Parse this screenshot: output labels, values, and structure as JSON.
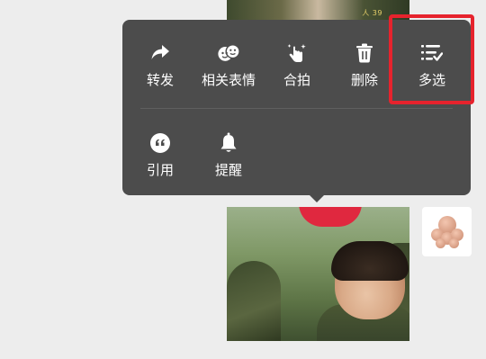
{
  "photo_top": {
    "badge_text": "人 39"
  },
  "menu": {
    "row1": [
      {
        "label": "转发",
        "icon": "forward-icon"
      },
      {
        "label": "相关表情",
        "icon": "sticker-icon"
      },
      {
        "label": "合拍",
        "icon": "hand-tap-icon"
      },
      {
        "label": "删除",
        "icon": "trash-icon"
      },
      {
        "label": "多选",
        "icon": "multi-select-icon"
      }
    ],
    "row2": [
      {
        "label": "引用",
        "icon": "quote-icon"
      },
      {
        "label": "提醒",
        "icon": "bell-icon"
      }
    ]
  },
  "colors": {
    "menu_bg": "#4c4c4c",
    "page_bg": "#ededed",
    "highlight": "#e6232d"
  }
}
